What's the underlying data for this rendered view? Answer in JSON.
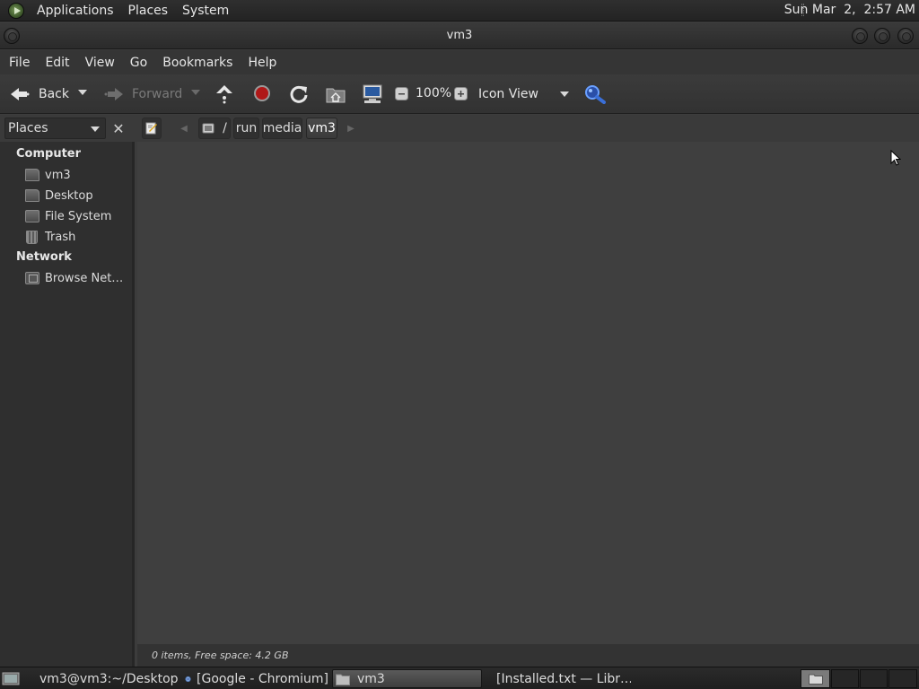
{
  "top_panel": {
    "menus": [
      "Applications",
      "Places",
      "System"
    ],
    "clock": "Sun Mar  2,  2:57 AM"
  },
  "window": {
    "title": "vm3"
  },
  "menubar": [
    "File",
    "Edit",
    "View",
    "Go",
    "Bookmarks",
    "Help"
  ],
  "toolbar": {
    "back_label": "Back",
    "forward_label": "Forward",
    "zoom": "100%",
    "view_mode": "Icon View"
  },
  "location": {
    "pane_selector": "Places",
    "root_separator": "/",
    "crumbs": [
      "run",
      "media",
      "vm3"
    ]
  },
  "sidebar": {
    "computer_header": "Computer",
    "computer_items": [
      "vm3",
      "Desktop",
      "File System",
      "Trash"
    ],
    "network_header": "Network",
    "network_items": [
      "Browse Net…"
    ]
  },
  "status": "0 items, Free space: 4.2 GB",
  "taskbar": {
    "tasks": [
      "vm3@vm3:~/Desktop",
      "[Google - Chromium]",
      "vm3",
      "[Installed.txt — Libr…"
    ]
  },
  "colors": {
    "panel_bg": "#2a2a2a",
    "content_bg": "#3f3f3f",
    "sidebar_bg": "#2f2f2f",
    "stop_red": "#b01818",
    "search_blue": "#3a6fd8"
  }
}
